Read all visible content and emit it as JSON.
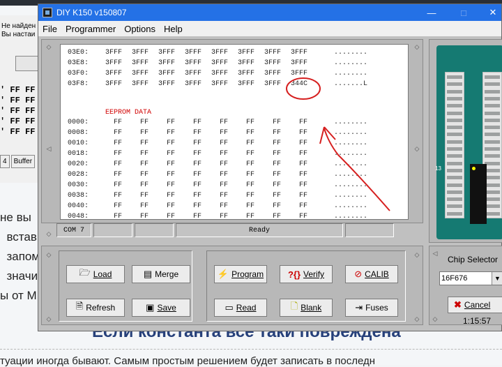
{
  "background": {
    "dialog_text": [
      "Не найден",
      "Вы настаи"
    ],
    "hex_rows": [
      "' FF FF",
      "' FF FF",
      "' FF FF",
      "' FF FF",
      "' FF FF"
    ],
    "tabs": [
      "4",
      "Buffer"
    ],
    "paragraph_lines": [
      "не вы",
      "  встав",
      "  запом",
      "  значи",
      "ы от М"
    ],
    "heading": "Если константа все таки повреждена",
    "bottom_text": "туации иногда бывают. Самым простым решением будет записать в последн"
  },
  "window": {
    "title": "DIY K150 v150807",
    "controls": {
      "minimize": "—",
      "maximize": "□",
      "close": "✕"
    },
    "menu": [
      "File",
      "Programmer",
      "Options",
      "Help"
    ]
  },
  "hexview": {
    "program_rows": [
      {
        "addr": "03E0:",
        "values": [
          "3FFF",
          "3FFF",
          "3FFF",
          "3FFF",
          "3FFF",
          "3FFF",
          "3FFF",
          "3FFF"
        ],
        "ascii": "........"
      },
      {
        "addr": "03E8:",
        "values": [
          "3FFF",
          "3FFF",
          "3FFF",
          "3FFF",
          "3FFF",
          "3FFF",
          "3FFF",
          "3FFF"
        ],
        "ascii": "........"
      },
      {
        "addr": "03F0:",
        "values": [
          "3FFF",
          "3FFF",
          "3FFF",
          "3FFF",
          "3FFF",
          "3FFF",
          "3FFF",
          "3FFF"
        ],
        "ascii": "........"
      },
      {
        "addr": "03F8:",
        "values": [
          "3FFF",
          "3FFF",
          "3FFF",
          "3FFF",
          "3FFF",
          "3FFF",
          "3FFF",
          "344C"
        ],
        "ascii": ".......L"
      }
    ],
    "eeprom_label": "EEPROM DATA",
    "eeprom_rows": [
      {
        "addr": "0000:",
        "values": [
          "FF",
          "FF",
          "FF",
          "FF",
          "FF",
          "FF",
          "FF",
          "FF"
        ],
        "ascii": "........"
      },
      {
        "addr": "0008:",
        "values": [
          "FF",
          "FF",
          "FF",
          "FF",
          "FF",
          "FF",
          "FF",
          "FF"
        ],
        "ascii": "........"
      },
      {
        "addr": "0010:",
        "values": [
          "FF",
          "FF",
          "FF",
          "FF",
          "FF",
          "FF",
          "FF",
          "FF"
        ],
        "ascii": "........"
      },
      {
        "addr": "0018:",
        "values": [
          "FF",
          "FF",
          "FF",
          "FF",
          "FF",
          "FF",
          "FF",
          "FF"
        ],
        "ascii": "........"
      },
      {
        "addr": "0020:",
        "values": [
          "FF",
          "FF",
          "FF",
          "FF",
          "FF",
          "FF",
          "FF",
          "FF"
        ],
        "ascii": "........"
      },
      {
        "addr": "0028:",
        "values": [
          "FF",
          "FF",
          "FF",
          "FF",
          "FF",
          "FF",
          "FF",
          "FF"
        ],
        "ascii": "........"
      },
      {
        "addr": "0030:",
        "values": [
          "FF",
          "FF",
          "FF",
          "FF",
          "FF",
          "FF",
          "FF",
          "FF"
        ],
        "ascii": "........"
      },
      {
        "addr": "0038:",
        "values": [
          "FF",
          "FF",
          "FF",
          "FF",
          "FF",
          "FF",
          "FF",
          "FF"
        ],
        "ascii": "........"
      },
      {
        "addr": "0040:",
        "values": [
          "FF",
          "FF",
          "FF",
          "FF",
          "FF",
          "FF",
          "FF",
          "FF"
        ],
        "ascii": "........"
      },
      {
        "addr": "0048:",
        "values": [
          "FF",
          "FF",
          "FF",
          "FF",
          "FF",
          "FF",
          "FF",
          "FF"
        ],
        "ascii": "........"
      }
    ]
  },
  "status": {
    "port": "COM 7",
    "message": "Ready"
  },
  "buttons": {
    "load": "Load",
    "merge": "Merge",
    "refresh": "Refresh",
    "save": "Save",
    "program": "Program",
    "verify": "Verify",
    "calib": "CALIB",
    "read": "Read",
    "blank": "Blank",
    "fuses": "Fuses"
  },
  "chip": {
    "pin_marker": "13",
    "selector_label": "Chip Selector",
    "selected": "16F676",
    "cancel": "Cancel",
    "clock": "1:15:57"
  },
  "colors": {
    "titlebar": "#2471e6",
    "socket": "#157a72",
    "eeprom_label": "#d00000",
    "annotation": "#d62020",
    "heading": "#26407a"
  },
  "icons": [
    "folder-icon",
    "merge-icon",
    "refresh-icon",
    "save-icon",
    "program-icon",
    "verify-icon",
    "calib-icon",
    "read-icon",
    "blank-icon",
    "fuses-icon",
    "cancel-icon"
  ]
}
